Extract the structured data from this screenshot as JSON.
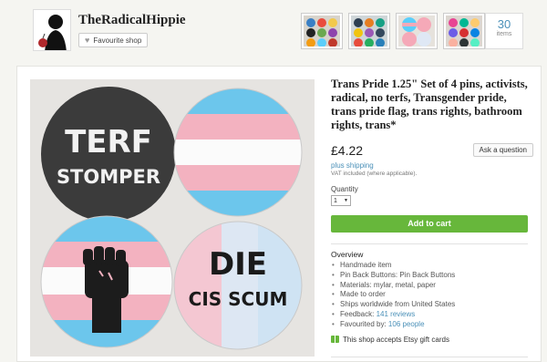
{
  "shop": {
    "name": "TheRadicalHippie",
    "favourite_label": "Favourite shop",
    "items_count": "30",
    "items_label": "items"
  },
  "listing": {
    "title": "Trans Pride 1.25\" Set of 4 pins, activists, radical, no terfs, Transgender pride, trans pride flag, trans rights, bathroom rights, trans*",
    "price": "£4.22",
    "ask_label": "Ask a question",
    "shipping": "plus shipping",
    "vat": "VAT included (where applicable).",
    "quantity_label": "Quantity",
    "quantity_value": "1",
    "cart_label": "Add to cart"
  },
  "photo": {
    "pin1_line1": "TERF",
    "pin1_line2": "STOMPER",
    "pin4_line1": "DIE",
    "pin4_line2": "CIS SCUM"
  },
  "overview": {
    "title": "Overview",
    "items": [
      "Handmade item",
      "Pin Back Buttons: Pin Back Buttons",
      "Materials: mylar, metal, paper",
      "Made to order",
      "Ships worldwide from United States"
    ],
    "feedback_prefix": "Feedback: ",
    "feedback_link": "141 reviews",
    "favourited_prefix": "Favourited by: ",
    "favourited_link": "106 people",
    "gift_text": "This shop accepts Etsy gift cards"
  },
  "colors": {
    "accent": "#67b73b",
    "link": "#4a90b8",
    "trans_blue": "#5bcefa",
    "trans_pink": "#f5a9b8",
    "trans_white": "#ffffff"
  }
}
